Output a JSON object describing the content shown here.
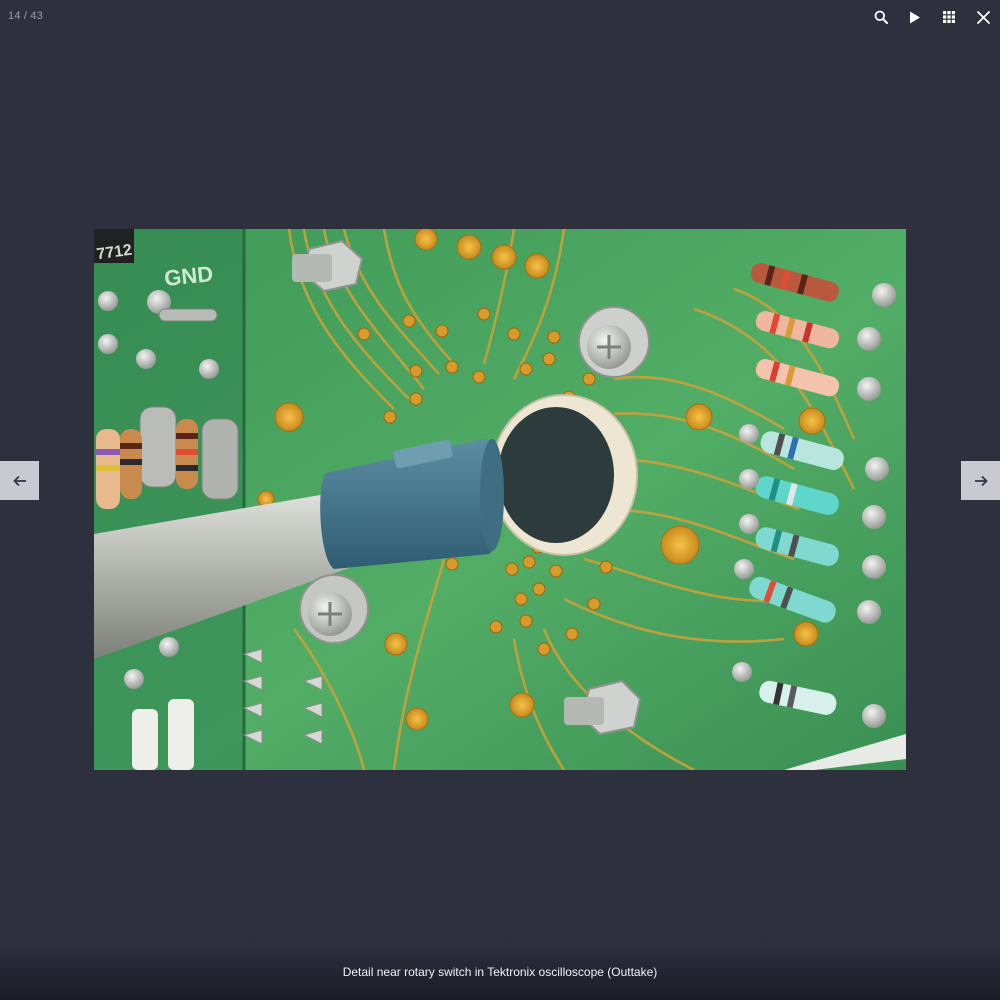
{
  "viewer": {
    "counter": "14 / 43",
    "caption": "Detail near rotary switch in Tektronix oscilloscope (Outtake)"
  },
  "toolbar": {
    "buttons": [
      {
        "icon": "search-icon"
      },
      {
        "icon": "play-icon"
      },
      {
        "icon": "grid-icon"
      },
      {
        "icon": "close-icon"
      }
    ]
  },
  "navigation": {
    "prev_icon": "arrow-left-icon",
    "next_icon": "arrow-right-icon"
  },
  "photo": {
    "board_labels": {
      "gnd": "GND",
      "chip": "7712"
    }
  },
  "colors": {
    "background": "#2e303e",
    "board_green": "#3f9a57",
    "trace_gold": "#c9a23a",
    "nav_button": "#c9cad1"
  }
}
